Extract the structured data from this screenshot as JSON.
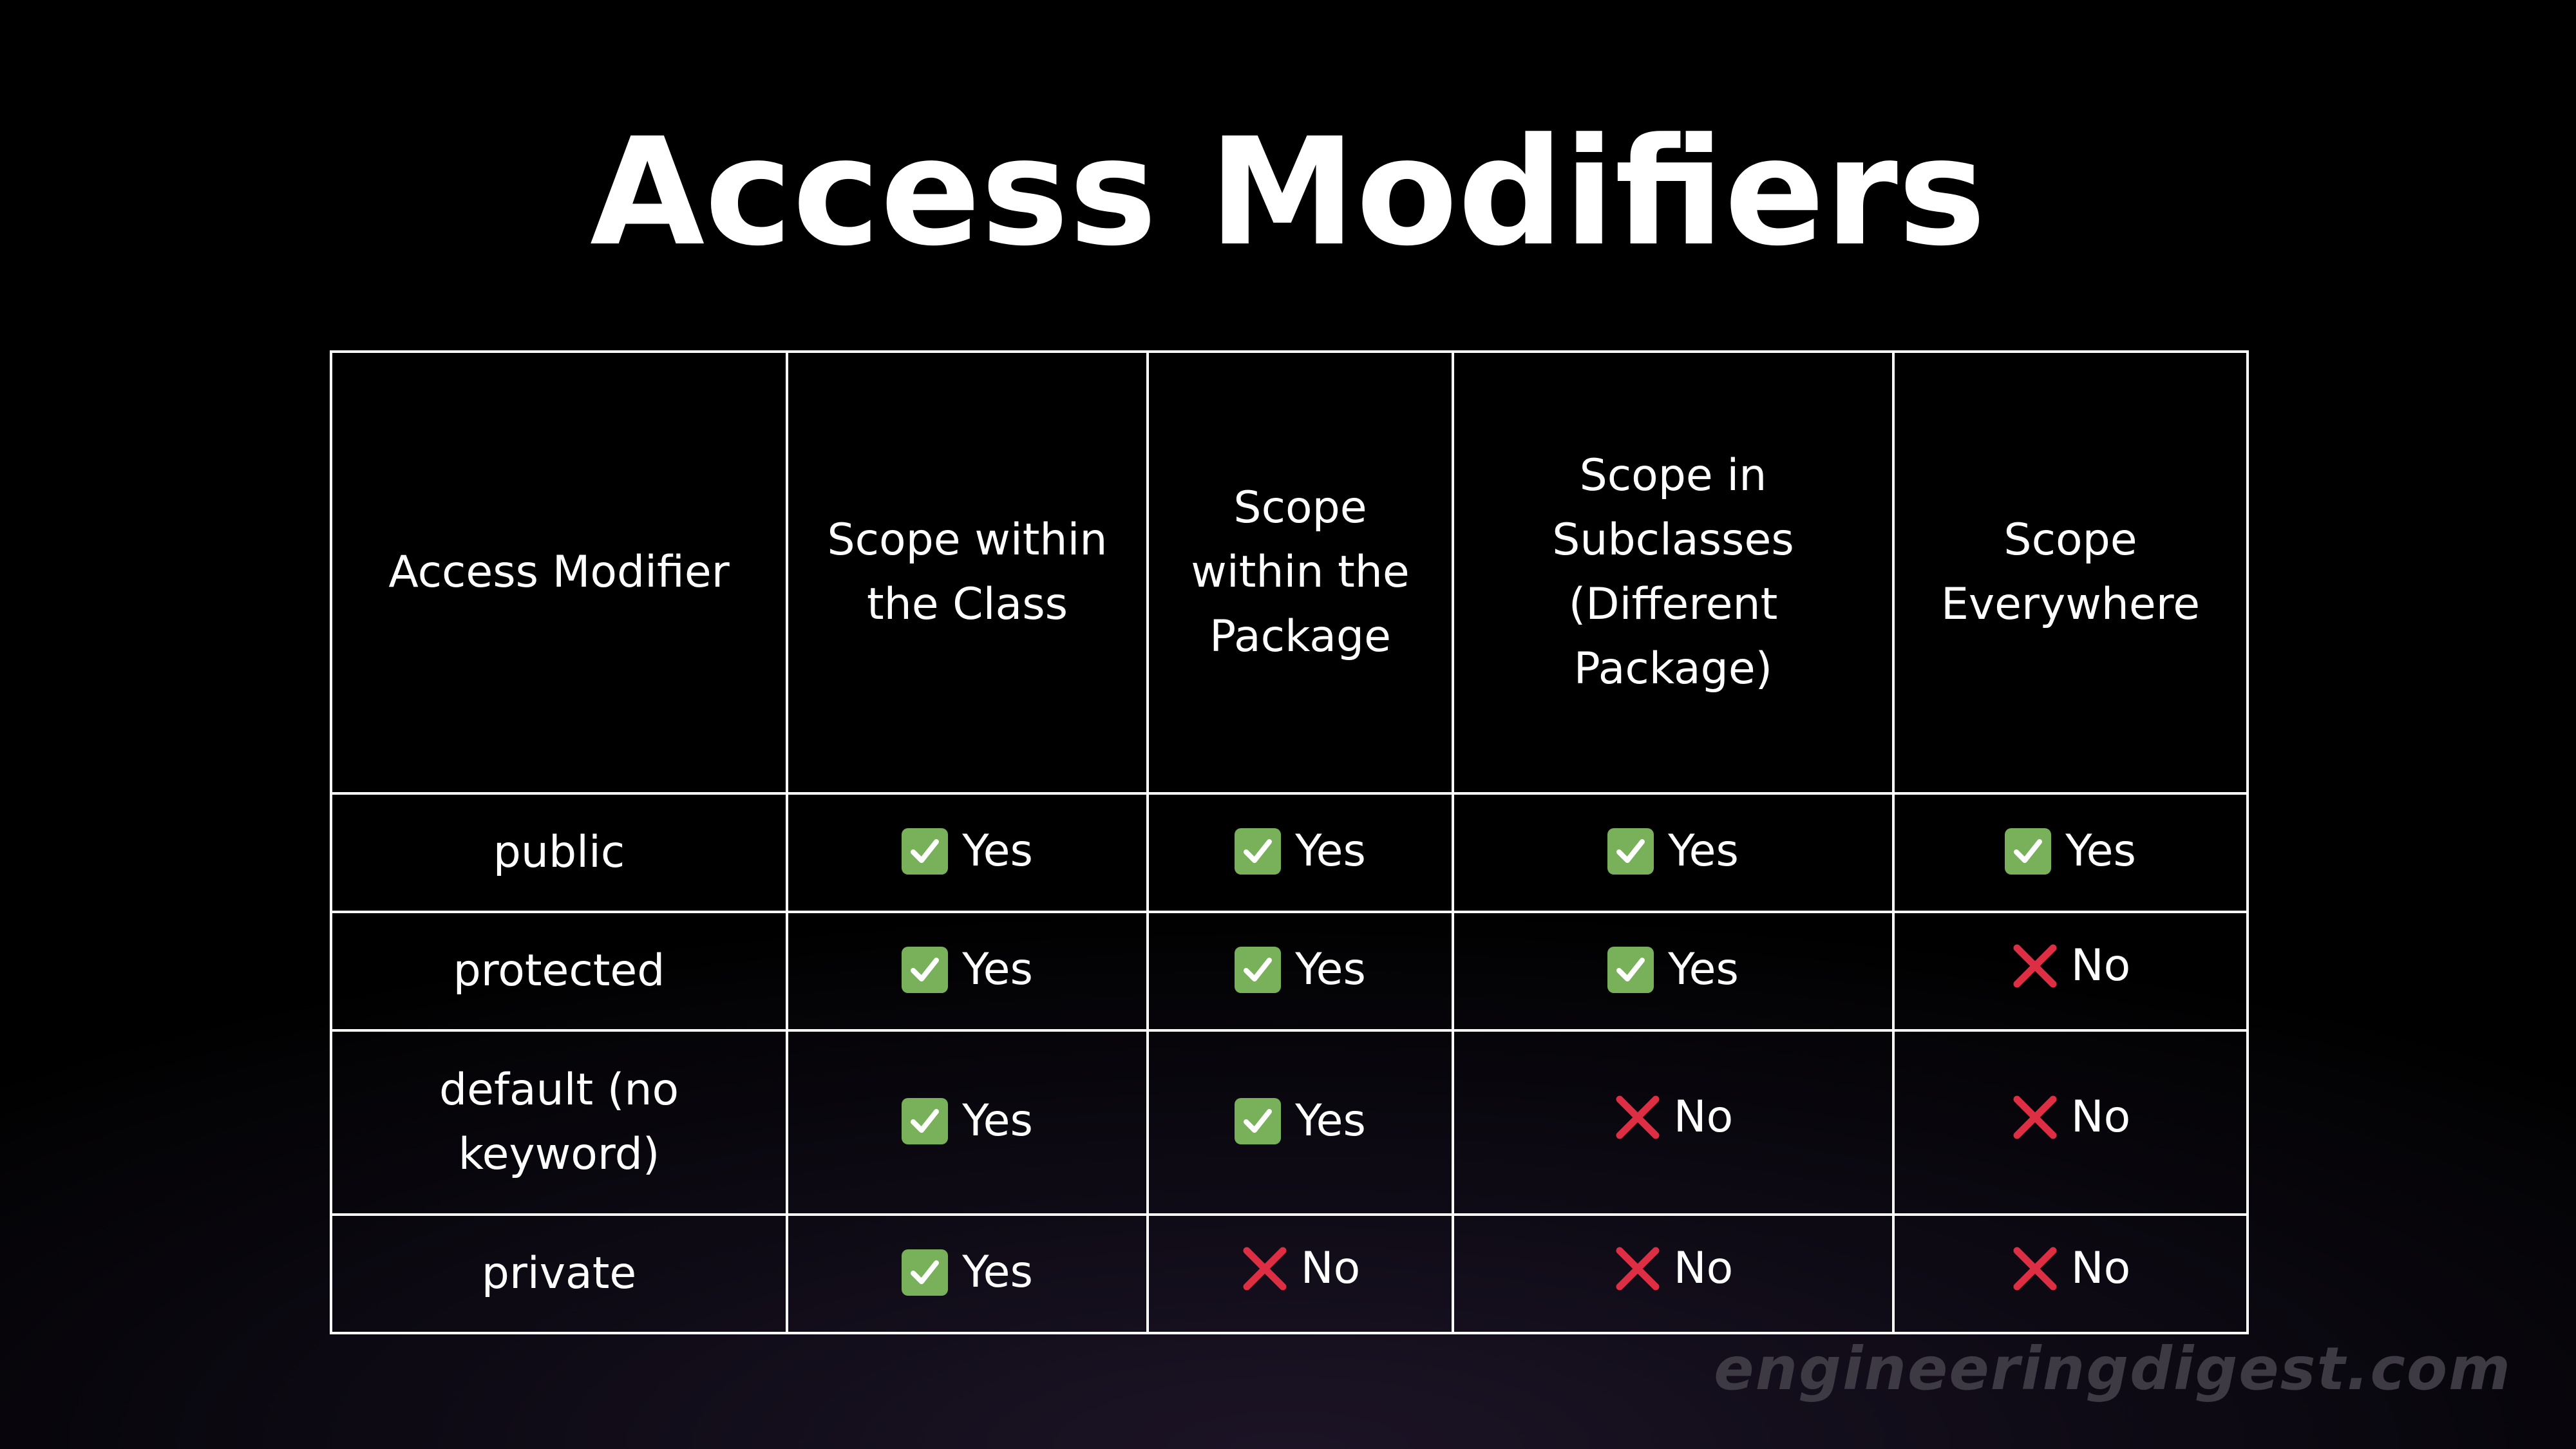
{
  "title": "Access Modifiers",
  "table": {
    "headers": [
      "Access Modifier",
      "Scope within the Class",
      "Scope within the Package",
      "Scope in Subclasses (Different Package)",
      "Scope Everywhere"
    ],
    "rows": [
      {
        "modifier": "public",
        "cells": [
          {
            "icon": "check-mark-icon",
            "text": "Yes"
          },
          {
            "icon": "check-mark-icon",
            "text": "Yes"
          },
          {
            "icon": "check-mark-icon",
            "text": "Yes"
          },
          {
            "icon": "check-mark-icon",
            "text": "Yes"
          }
        ]
      },
      {
        "modifier": "protected",
        "cells": [
          {
            "icon": "check-mark-icon",
            "text": "Yes"
          },
          {
            "icon": "check-mark-icon",
            "text": "Yes"
          },
          {
            "icon": "check-mark-icon",
            "text": "Yes"
          },
          {
            "icon": "cross-mark-icon",
            "text": "No"
          }
        ]
      },
      {
        "modifier": "default (no keyword)",
        "cells": [
          {
            "icon": "check-mark-icon",
            "text": "Yes"
          },
          {
            "icon": "check-mark-icon",
            "text": "Yes"
          },
          {
            "icon": "cross-mark-icon",
            "text": "No"
          },
          {
            "icon": "cross-mark-icon",
            "text": "No"
          }
        ]
      },
      {
        "modifier": "private",
        "cells": [
          {
            "icon": "check-mark-icon",
            "text": "Yes"
          },
          {
            "icon": "cross-mark-icon",
            "text": "No"
          },
          {
            "icon": "cross-mark-icon",
            "text": "No"
          },
          {
            "icon": "cross-mark-icon",
            "text": "No"
          }
        ]
      }
    ]
  },
  "watermark": "engineeringdigest.com",
  "colors": {
    "background": "#000000",
    "text": "#ffffff",
    "check_box": "#78b159",
    "cross": "#dd2e44",
    "watermark": "#3d3a44"
  }
}
